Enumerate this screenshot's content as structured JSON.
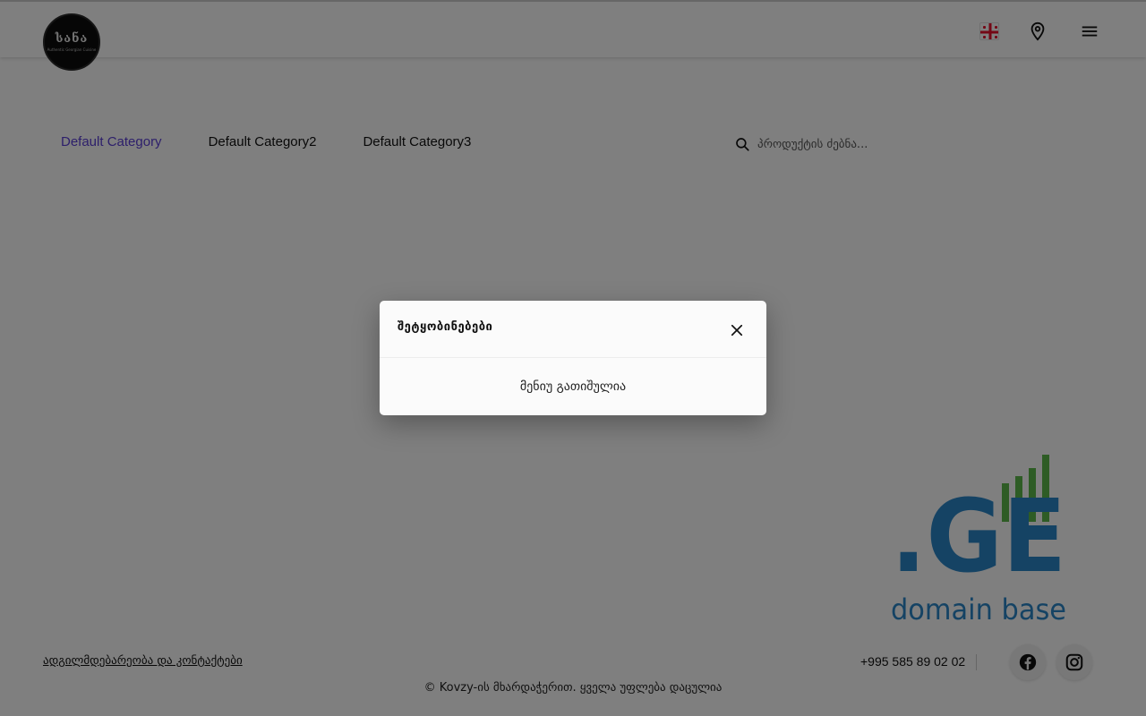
{
  "header": {
    "logo_text": "სანა",
    "logo_subtext": "Authentic Georgian Cuisine",
    "flag_icon": "georgia-flag-icon",
    "location_icon": "location-pin-icon",
    "menu_icon": "hamburger-menu-icon"
  },
  "categories": [
    {
      "label": "Default Category",
      "active": true
    },
    {
      "label": "Default Category2",
      "active": false
    },
    {
      "label": "Default Category3",
      "active": false
    }
  ],
  "search": {
    "placeholder": "პროდუქტის ძებნა...",
    "icon": "search-icon"
  },
  "domain_badge": {
    "mark": ".GE",
    "caption": "domain base"
  },
  "footer": {
    "location_link": "ადგილმდებარეობა და კონტაქტები",
    "phone": "+995 585 89 02 02",
    "copyright": "© Kovzy-ის მხარდაჭერით. ყველა უფლება დაცულია",
    "social": [
      "facebook-icon",
      "instagram-icon"
    ]
  },
  "modal": {
    "title": "შეტყობინებები",
    "message": "მენიუ გათიშულია",
    "close_icon": "close-icon"
  },
  "colors": {
    "accent": "#5b3fd6",
    "badge_blue": "#2b86c9",
    "badge_green": "#5cb84a",
    "flag_red": "#e8112d"
  }
}
